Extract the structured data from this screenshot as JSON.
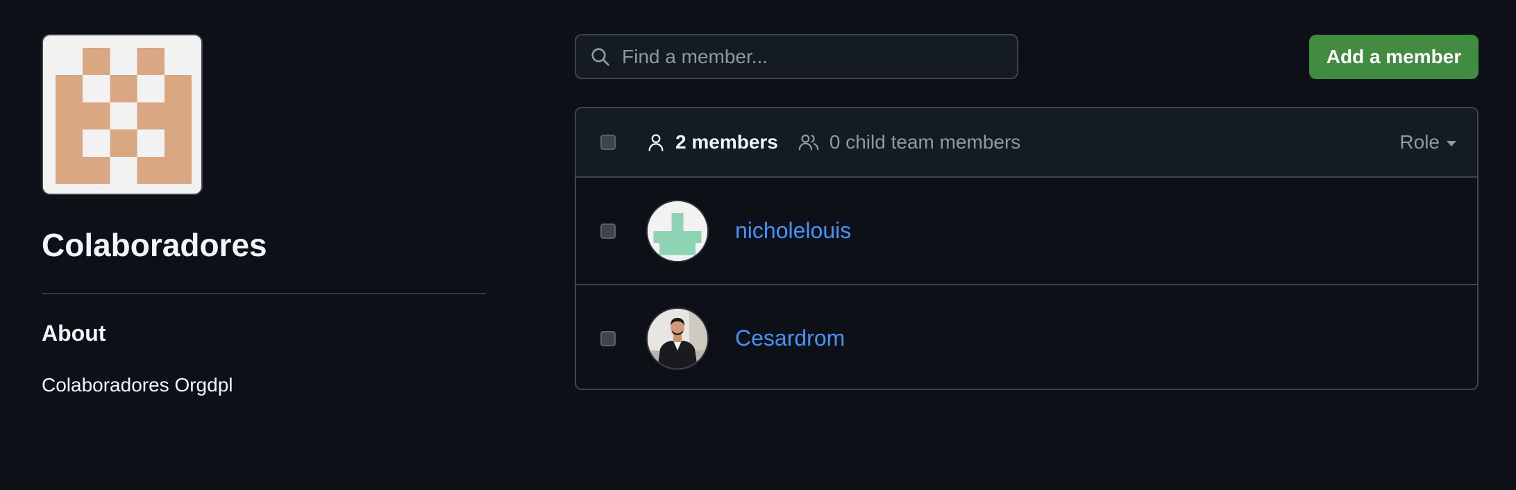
{
  "team": {
    "name": "Colaboradores",
    "about_title": "About",
    "about_text": "Colaboradores Orgdpl",
    "avatar_color": "#d9a882"
  },
  "search": {
    "placeholder": "Find a member..."
  },
  "add_member_label": "Add a member",
  "list": {
    "members_count": "2 members",
    "child_members": "0 child team members",
    "role_filter": "Role",
    "members": [
      {
        "username": "nicholelouis",
        "avatar_color": "#8dd4b4"
      },
      {
        "username": "Cesardrom"
      }
    ]
  },
  "colors": {
    "background": "#0d1117",
    "link": "#4493f8",
    "primary_button": "#428c42"
  }
}
